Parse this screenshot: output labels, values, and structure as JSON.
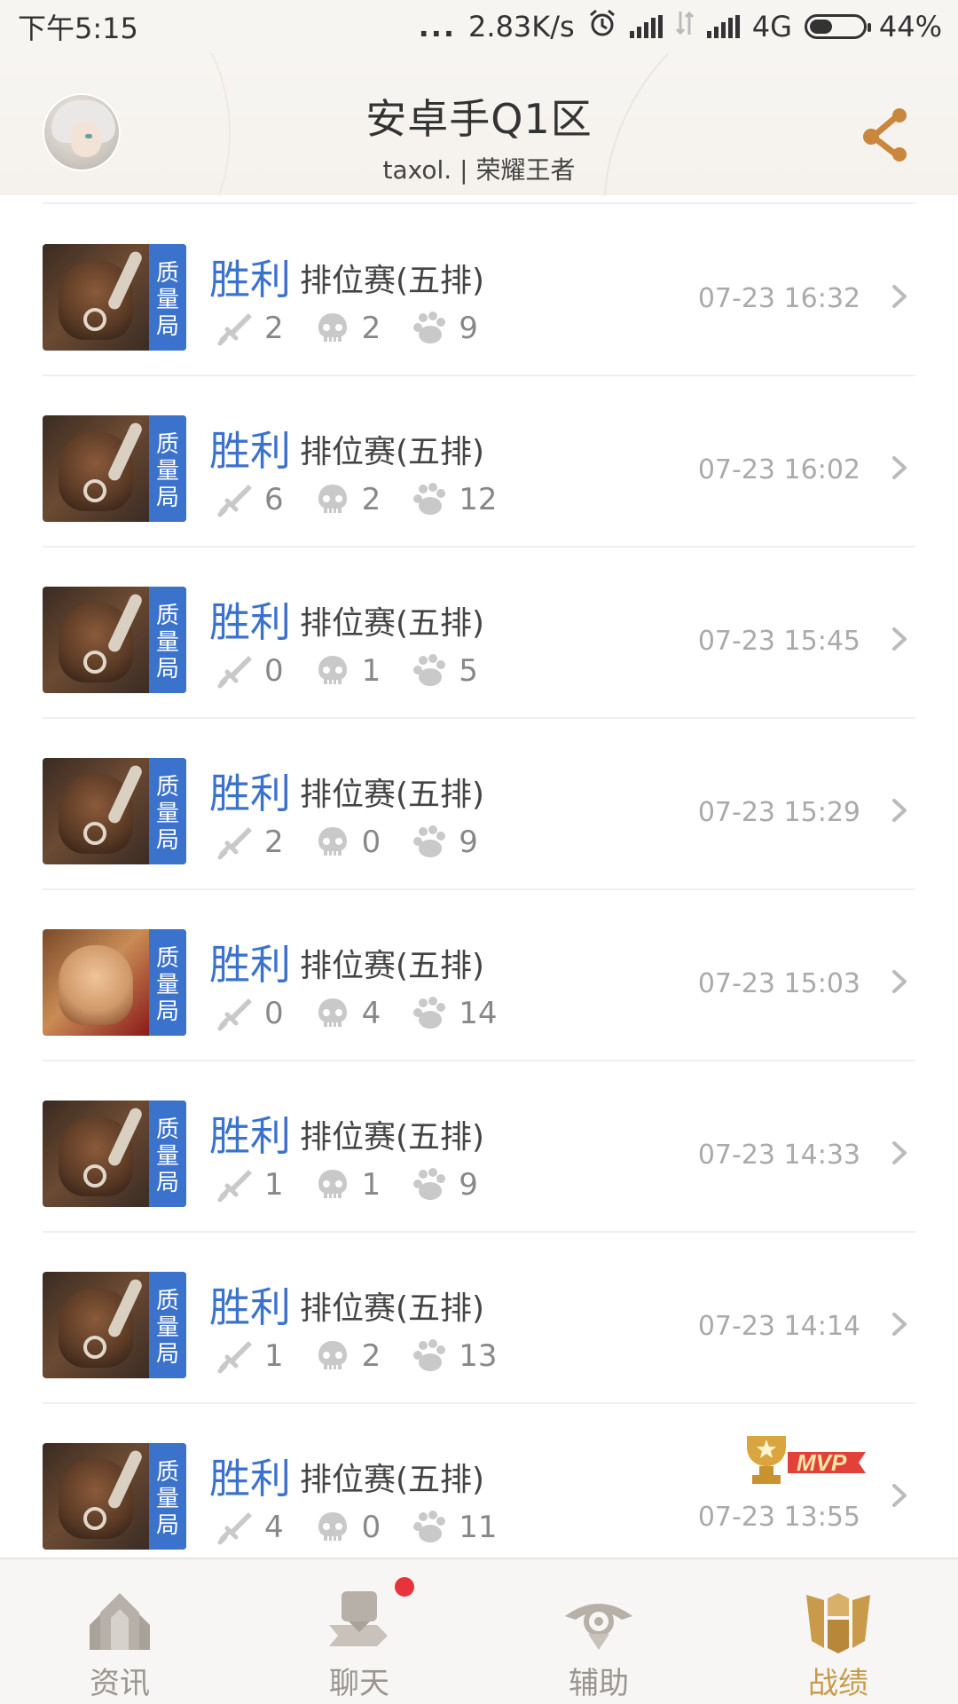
{
  "status_bar": {
    "time": "下午5:15",
    "dots": "...",
    "net_speed": "2.83K/s",
    "network_type": "4G",
    "battery": "44%",
    "battery_level": 0.44
  },
  "header": {
    "server": "安卓手Q1区",
    "player_line": "taxol. | 荣耀王者"
  },
  "colors": {
    "accent_blue": "#3b72cc",
    "accent_gold": "#c89a4a",
    "notify_red": "#e8333b"
  },
  "matches": [
    {
      "badge": [
        "质",
        "量",
        "局"
      ],
      "result": "胜利",
      "mode": "排位赛(五排)",
      "kills": "2",
      "deaths": "2",
      "assists": "9",
      "time": "07-23 16:32",
      "hero_style": "dark",
      "mvp": false
    },
    {
      "badge": [
        "质",
        "量",
        "局"
      ],
      "result": "胜利",
      "mode": "排位赛(五排)",
      "kills": "6",
      "deaths": "2",
      "assists": "12",
      "time": "07-23 16:02",
      "hero_style": "dark",
      "mvp": false
    },
    {
      "badge": [
        "质",
        "量",
        "局"
      ],
      "result": "胜利",
      "mode": "排位赛(五排)",
      "kills": "0",
      "deaths": "1",
      "assists": "5",
      "time": "07-23 15:45",
      "hero_style": "dark",
      "mvp": false
    },
    {
      "badge": [
        "质",
        "量",
        "局"
      ],
      "result": "胜利",
      "mode": "排位赛(五排)",
      "kills": "2",
      "deaths": "0",
      "assists": "9",
      "time": "07-23 15:29",
      "hero_style": "dark",
      "mvp": false
    },
    {
      "badge": [
        "质",
        "量",
        "局"
      ],
      "result": "胜利",
      "mode": "排位赛(五排)",
      "kills": "0",
      "deaths": "4",
      "assists": "14",
      "time": "07-23 15:03",
      "hero_style": "red",
      "mvp": false
    },
    {
      "badge": [
        "质",
        "量",
        "局"
      ],
      "result": "胜利",
      "mode": "排位赛(五排)",
      "kills": "1",
      "deaths": "1",
      "assists": "9",
      "time": "07-23 14:33",
      "hero_style": "dark",
      "mvp": false
    },
    {
      "badge": [
        "质",
        "量",
        "局"
      ],
      "result": "胜利",
      "mode": "排位赛(五排)",
      "kills": "1",
      "deaths": "2",
      "assists": "13",
      "time": "07-23 14:14",
      "hero_style": "dark",
      "mvp": false
    },
    {
      "badge": [
        "质",
        "量",
        "局"
      ],
      "result": "胜利",
      "mode": "排位赛(五排)",
      "kills": "4",
      "deaths": "0",
      "assists": "11",
      "time": "07-23 13:55",
      "hero_style": "dark",
      "mvp": true,
      "mvp_label": "MVP"
    }
  ],
  "nav": {
    "items": [
      {
        "label": "资讯",
        "icon": "news-icon",
        "active": false
      },
      {
        "label": "聊天",
        "icon": "chat-icon",
        "active": false,
        "has_notification": true
      },
      {
        "label": "辅助",
        "icon": "assist-icon",
        "active": false
      },
      {
        "label": "战绩",
        "icon": "records-icon",
        "active": true
      }
    ]
  }
}
